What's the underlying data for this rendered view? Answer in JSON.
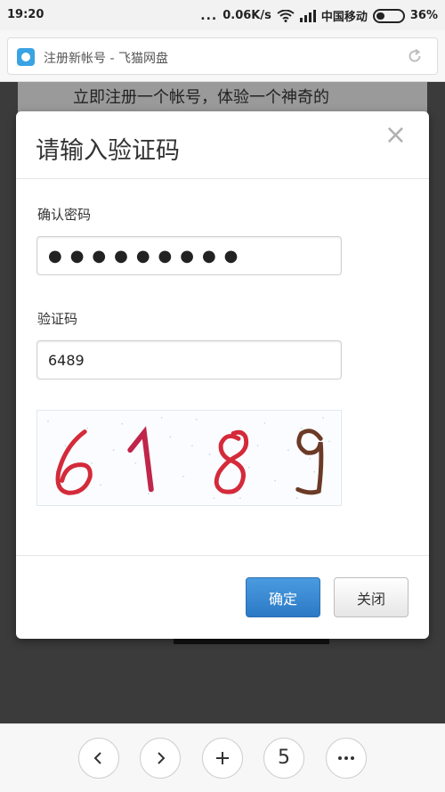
{
  "status_bar": {
    "time": "19:20",
    "dots": "...",
    "speed": "0.06K/s",
    "carrier": "中国移动",
    "battery": "36%"
  },
  "browser": {
    "page_title": "注册新帐号 - 飞猫网盘"
  },
  "background": {
    "text": "立即注册一个帐号，体验一个神奇的"
  },
  "modal": {
    "title": "请输入验证码",
    "close_symbol": "×",
    "confirm_password_label": "确认密码",
    "password_masked": "●●●●●●●●●",
    "captcha_label": "验证码",
    "captcha_value": "6489",
    "captcha_image_text": "6189",
    "confirm_button": "确定",
    "close_button": "关闭"
  },
  "bottom_nav": {
    "tab_count": "5"
  },
  "colors": {
    "primary": "#2b79c5",
    "captcha_red": "#d42a3a",
    "captcha_pink": "#c0254a",
    "captcha_brown": "#6b3a26"
  }
}
